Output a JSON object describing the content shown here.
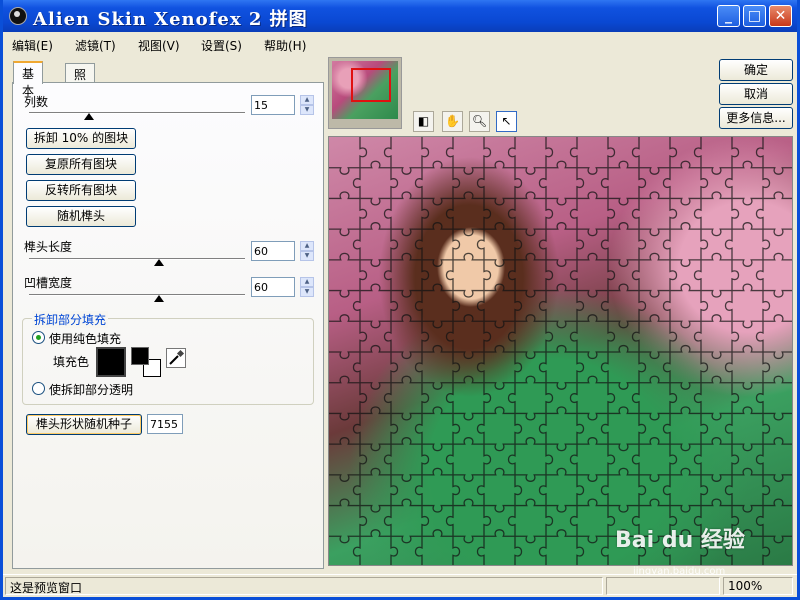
{
  "window": {
    "title": "Alien Skin Xenofex 2 拼图"
  },
  "titlebar_buttons": {
    "minimize": "_",
    "maximize": "□",
    "close": "✕"
  },
  "menu": [
    {
      "label": "编辑(E)"
    },
    {
      "label": "滤镜(T)"
    },
    {
      "label": "视图(V)"
    },
    {
      "label": "设置(S)"
    },
    {
      "label": "帮助(H)"
    }
  ],
  "tabs": [
    {
      "label": "基本",
      "active": true
    },
    {
      "label": "照明",
      "active": false
    }
  ],
  "controls": {
    "columns": {
      "label": "列数",
      "value": "15",
      "slider_level": 0.28
    },
    "remove_button": "拆卸 10% 的图块",
    "restore_button": "复原所有图块",
    "invert_button": "反转所有图块",
    "random_button": "随机榫头",
    "tenon_length": {
      "label": "榫头长度",
      "value": "60",
      "slider_level": 0.6
    },
    "groove_width": {
      "label": "凹槽宽度",
      "value": "60",
      "slider_level": 0.6
    }
  },
  "fill_group": {
    "title": "拆卸部分填充",
    "option_solid": "使用纯色填充",
    "fill_color_label": "填充色",
    "option_transparent": "使拆卸部分透明",
    "selected": "solid",
    "colors": {
      "fill": "#000000",
      "foreground": "#000000",
      "background": "#ffffff"
    }
  },
  "seed": {
    "button": "榫头形状随机种子",
    "value": "7155"
  },
  "right_buttons": {
    "ok": "确定",
    "cancel": "取消",
    "more_info": "更多信息..."
  },
  "tools": [
    "preview-toggle-icon",
    "hand-icon",
    "zoom-icon",
    "pointer-icon"
  ],
  "watermark": {
    "text": "Bai du 经验",
    "sub": "jingyan.baidu.com"
  },
  "status": {
    "message": "这是预览窗口",
    "zoom": "100%"
  },
  "colors": {
    "title_blue": "#0a48d2",
    "group_title": "#0046d5",
    "thumb_highlight": "#e01010"
  }
}
